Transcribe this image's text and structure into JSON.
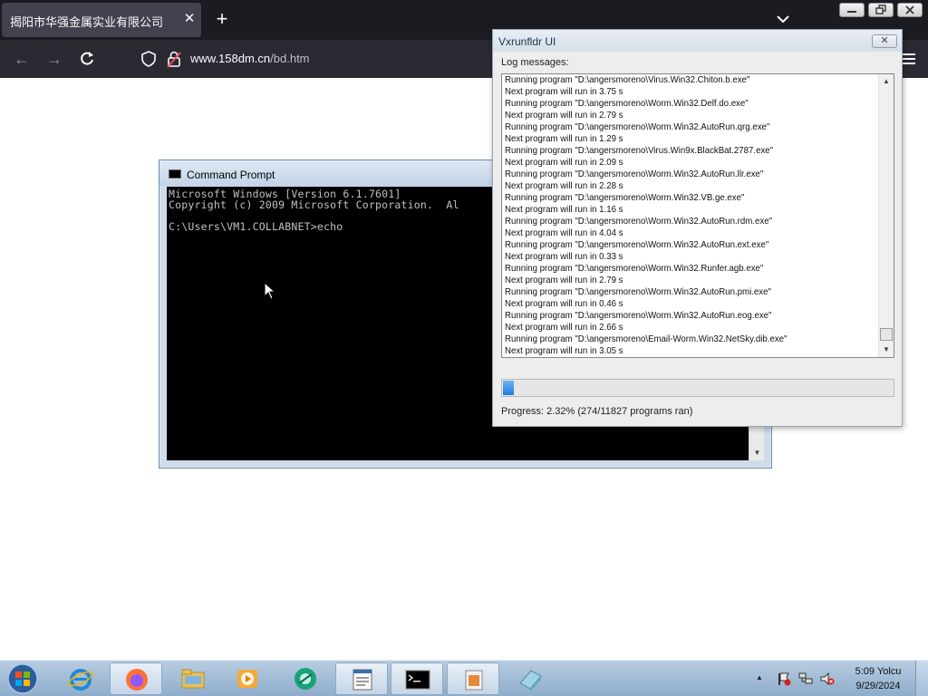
{
  "browser": {
    "tab_title": "揭阳市华强金属实业有限公司",
    "tab_close": "✕",
    "new_tab": "+",
    "url_host": "www.158dm.cn",
    "url_path": "/bd.htm"
  },
  "cmd": {
    "title": "Command Prompt",
    "lines": [
      "Microsoft Windows [Version 6.1.7601]",
      "Copyright (c) 2009 Microsoft Corporation.  Al",
      "",
      "C:\\Users\\VM1.COLLABNET>echo"
    ]
  },
  "vxrunfldr": {
    "title": "Vxrunfldr UI",
    "close": "✕",
    "log_label": "Log messages:",
    "log": [
      "Running program \"D:\\angersmoreno\\Virus.Win32.Chiton.b.exe\"",
      "Next program will run in 3.75 s",
      "Running program \"D:\\angersmoreno\\Worm.Win32.Delf.do.exe\"",
      "Next program will run in 2.79 s",
      "Running program \"D:\\angersmoreno\\Worm.Win32.AutoRun.qrg.exe\"",
      "Next program will run in 1.29 s",
      "Running program \"D:\\angersmoreno\\Virus.Win9x.BlackBat.2787.exe\"",
      "Next program will run in 2.09 s",
      "Running program \"D:\\angersmoreno\\Worm.Win32.AutoRun.llr.exe\"",
      "Next program will run in 2.28 s",
      "Running program \"D:\\angersmoreno\\Worm.Win32.VB.ge.exe\"",
      "Next program will run in 1.16 s",
      "Running program \"D:\\angersmoreno\\Worm.Win32.AutoRun.rdm.exe\"",
      "Next program will run in 4.04 s",
      "Running program \"D:\\angersmoreno\\Worm.Win32.AutoRun.ext.exe\"",
      "Next program will run in 0.33 s",
      "Running program \"D:\\angersmoreno\\Worm.Win32.Runfer.agb.exe\"",
      "Next program will run in 2.79 s",
      "Running program \"D:\\angersmoreno\\Worm.Win32.AutoRun.pmi.exe\"",
      "Next program will run in 0.46 s",
      "Running program \"D:\\angersmoreno\\Worm.Win32.AutoRun.eog.exe\"",
      "Next program will run in 2.66 s",
      "Running program \"D:\\angersmoreno\\Email-Worm.Win32.NetSky.dib.exe\"",
      "Next program will run in 3.05 s"
    ],
    "progress_fraction": 0.0232,
    "progress_text": "Progress: 2.32% (274/11827 programs ran)"
  },
  "taskbar": {
    "clock_time": "5:09 Yolcu",
    "clock_date": "9/29/2024"
  },
  "colors": {
    "browser_tabstrip": "#1c1b22",
    "browser_navbar": "#2b2a33",
    "progress_fill": "#1f7fe0",
    "console_bg": "#000000"
  }
}
